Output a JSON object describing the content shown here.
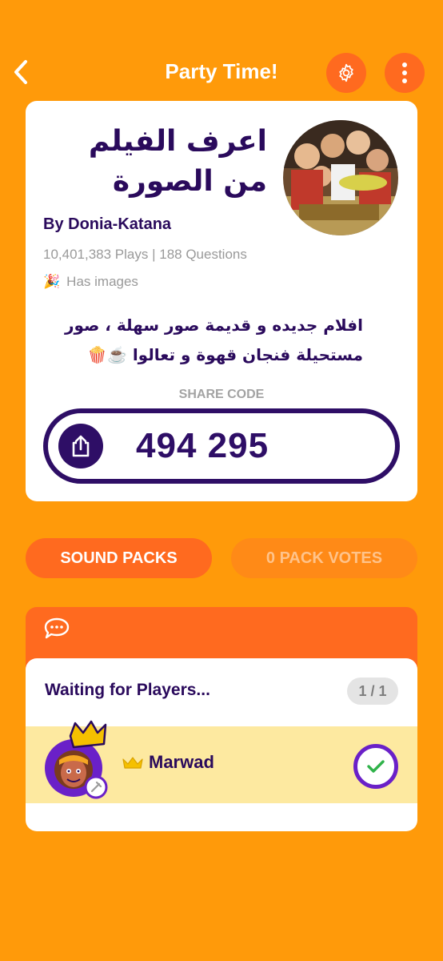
{
  "header": {
    "title": "Party Time!"
  },
  "quiz": {
    "title": "اعرف الفيلم من الصورة",
    "author": "By Donia-Katana",
    "stats": "10,401,383 Plays | 188 Questions",
    "images_label": "Has images",
    "images_emoji": "🎉",
    "description": "افلام جديده و قديمة صور سهلة ، صور مستحيلة فنجان قهوة و تعالوا ☕️🍿",
    "share_label": "SHARE CODE",
    "share_code": "494 295"
  },
  "pills": {
    "sound_packs": "SOUND PACKS",
    "pack_votes": "0 PACK VOTES"
  },
  "players": {
    "title": "Waiting for Players...",
    "count": "1 / 1",
    "list": [
      {
        "name": "Marwad",
        "is_host": true,
        "ready": true
      }
    ]
  },
  "colors": {
    "background": "#ff9a0a",
    "accent_orange": "#ff6a1f",
    "brand_purple": "#2e0e66",
    "player_row": "#fde9a0",
    "check_green": "#2fb24a"
  },
  "icons": {
    "back": "chevron-left-icon",
    "settings": "gear-icon",
    "more": "more-vertical-icon",
    "share": "share-icon",
    "chat": "chat-bubble-icon",
    "host": "crown-icon",
    "ready": "check-icon",
    "edit": "pencil-icon"
  }
}
